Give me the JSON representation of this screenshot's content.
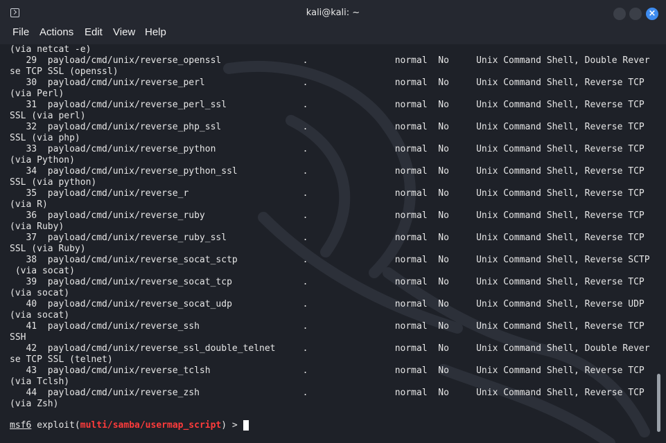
{
  "window": {
    "title": "kali@kali: ~"
  },
  "menu": [
    "File",
    "Actions",
    "Edit",
    "View",
    "Help"
  ],
  "terminal": {
    "lines": [
      "(via netcat -e)",
      "   29  payload/cmd/unix/reverse_openssl               .                normal  No     Unix Command Shell, Double Rever",
      "se TCP SSL (openssl)",
      "   30  payload/cmd/unix/reverse_perl                  .                normal  No     Unix Command Shell, Reverse TCP",
      "(via Perl)",
      "   31  payload/cmd/unix/reverse_perl_ssl              .                normal  No     Unix Command Shell, Reverse TCP",
      "SSL (via perl)",
      "   32  payload/cmd/unix/reverse_php_ssl               .                normal  No     Unix Command Shell, Reverse TCP",
      "SSL (via php)",
      "   33  payload/cmd/unix/reverse_python                .                normal  No     Unix Command Shell, Reverse TCP",
      "(via Python)",
      "   34  payload/cmd/unix/reverse_python_ssl            .                normal  No     Unix Command Shell, Reverse TCP",
      "SSL (via python)",
      "   35  payload/cmd/unix/reverse_r                     .                normal  No     Unix Command Shell, Reverse TCP",
      "(via R)",
      "   36  payload/cmd/unix/reverse_ruby                  .                normal  No     Unix Command Shell, Reverse TCP",
      "(via Ruby)",
      "   37  payload/cmd/unix/reverse_ruby_ssl              .                normal  No     Unix Command Shell, Reverse TCP",
      "SSL (via Ruby)",
      "   38  payload/cmd/unix/reverse_socat_sctp            .                normal  No     Unix Command Shell, Reverse SCTP",
      " (via socat)",
      "   39  payload/cmd/unix/reverse_socat_tcp             .                normal  No     Unix Command Shell, Reverse TCP",
      "(via socat)",
      "   40  payload/cmd/unix/reverse_socat_udp             .                normal  No     Unix Command Shell, Reverse UDP",
      "(via socat)",
      "   41  payload/cmd/unix/reverse_ssh                   .                normal  No     Unix Command Shell, Reverse TCP",
      "SSH",
      "   42  payload/cmd/unix/reverse_ssl_double_telnet     .                normal  No     Unix Command Shell, Double Rever",
      "se TCP SSL (telnet)",
      "   43  payload/cmd/unix/reverse_tclsh                 .                normal  No     Unix Command Shell, Reverse TCP",
      "(via Tclsh)",
      "   44  payload/cmd/unix/reverse_zsh                   .                normal  No     Unix Command Shell, Reverse TCP",
      "(via Zsh)"
    ],
    "prompt": {
      "app": "msf6",
      "cmd": " exploit(",
      "module": "multi/samba/usermap_script",
      "suffix": ") > "
    }
  },
  "icons": {
    "app": "terminal-icon",
    "minimize": "minimize-icon",
    "maximize": "maximize-icon",
    "close": "close-icon"
  },
  "colors": {
    "background": "#1e2128",
    "text": "#e6e6e6",
    "module": "#ff3b3b",
    "close_button": "#3e8cf0"
  }
}
